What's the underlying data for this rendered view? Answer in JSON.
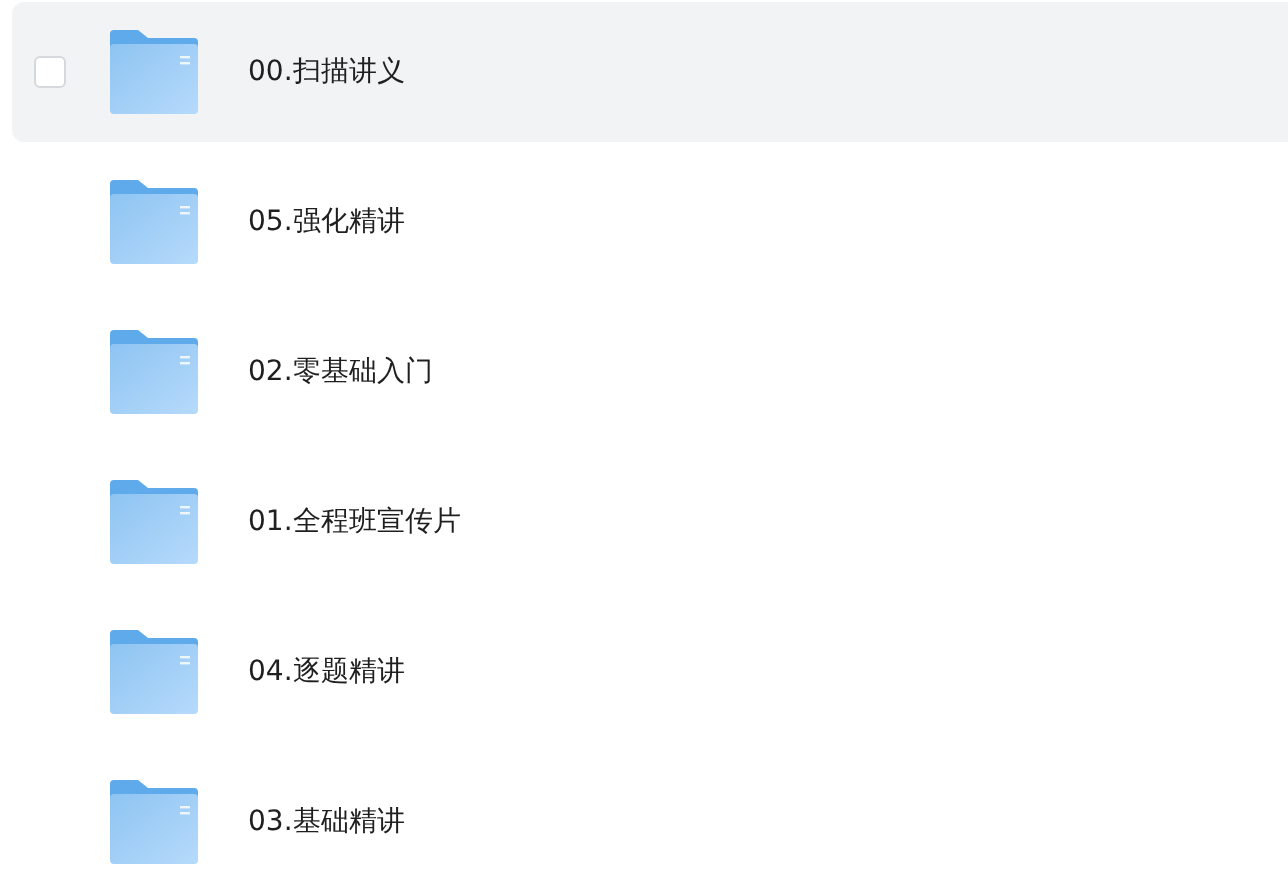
{
  "files": [
    {
      "name": "00.扫描讲义",
      "hovered": true,
      "checked": false
    },
    {
      "name": "05.强化精讲",
      "hovered": false,
      "checked": false
    },
    {
      "name": "02.零基础入门",
      "hovered": false,
      "checked": false
    },
    {
      "name": "01.全程班宣传片",
      "hovered": false,
      "checked": false
    },
    {
      "name": "04.逐题精讲",
      "hovered": false,
      "checked": false
    },
    {
      "name": "03.基础精讲",
      "hovered": false,
      "checked": false
    }
  ]
}
